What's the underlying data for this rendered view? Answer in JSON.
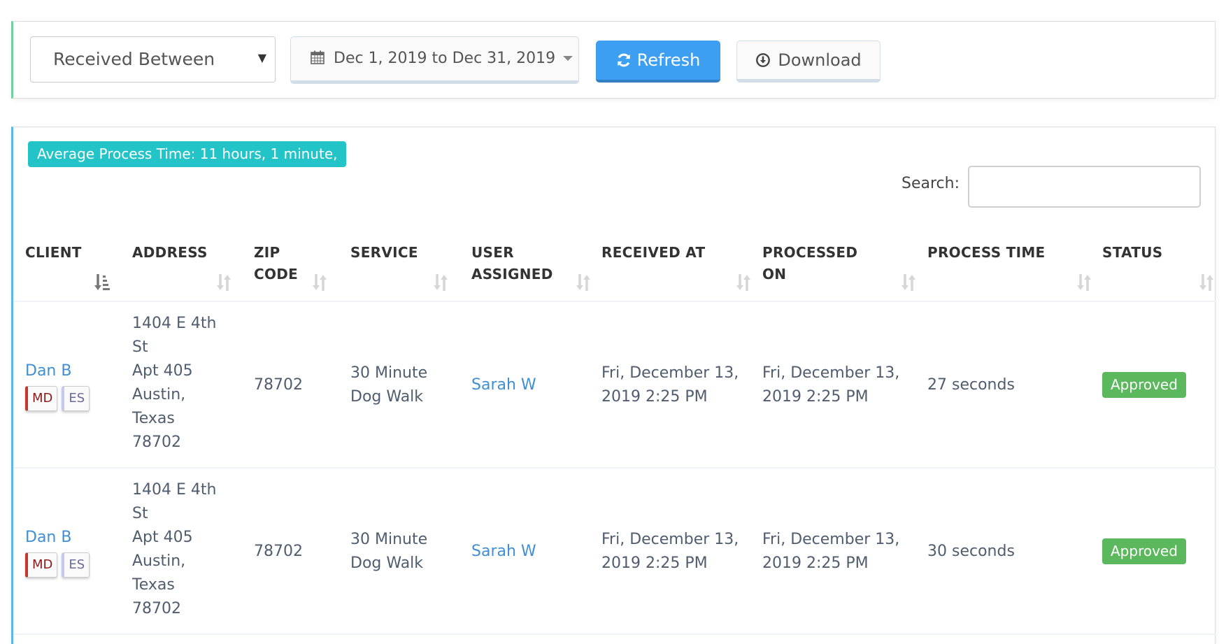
{
  "filters": {
    "date_field_select": "Received Between",
    "date_range": "Dec 1, 2019 to Dec 31, 2019",
    "refresh_label": "Refresh",
    "download_label": "Download"
  },
  "summary": {
    "average_process_time": "Average Process Time: 11 hours, 1 minute,"
  },
  "search": {
    "label": "Search:",
    "value": "",
    "placeholder": ""
  },
  "table": {
    "columns": [
      {
        "label": "CLIENT",
        "sort": "ascending"
      },
      {
        "label": "ADDRESS",
        "sort": "none"
      },
      {
        "label": "ZIP CODE",
        "sort": "none"
      },
      {
        "label": "SERVICE",
        "sort": "none"
      },
      {
        "label": "USER ASSIGNED",
        "sort": "none"
      },
      {
        "label": "RECEIVED AT",
        "sort": "none"
      },
      {
        "label": "PROCESSED ON",
        "sort": "none"
      },
      {
        "label": "PROCESS TIME",
        "sort": "none"
      },
      {
        "label": "STATUS",
        "sort": "none"
      }
    ],
    "rows": [
      {
        "client": "Dan B",
        "tags": [
          "MD",
          "ES"
        ],
        "address_lines": [
          "1404 E 4th",
          "St",
          "Apt 405",
          "Austin,",
          "Texas",
          "78702"
        ],
        "zip": "78702",
        "service_lines": [
          "30 Minute",
          "Dog Walk"
        ],
        "user_assigned": "Sarah W",
        "received_at_lines": [
          "Fri, December 13,",
          "2019 2:25 PM"
        ],
        "processed_on_lines": [
          "Fri, December 13,",
          "2019 2:25 PM"
        ],
        "process_time": "27 seconds",
        "status": "Approved"
      },
      {
        "client": "Dan B",
        "tags": [
          "MD",
          "ES"
        ],
        "address_lines": [
          "1404 E 4th",
          "St",
          "Apt 405",
          "Austin,",
          "Texas",
          "78702"
        ],
        "zip": "78702",
        "service_lines": [
          "30 Minute",
          "Dog Walk"
        ],
        "user_assigned": "Sarah W",
        "received_at_lines": [
          "Fri, December 13,",
          "2019 2:25 PM"
        ],
        "processed_on_lines": [
          "Fri, December 13,",
          "2019 2:25 PM"
        ],
        "process_time": "30 seconds",
        "status": "Approved"
      }
    ]
  },
  "colors": {
    "primary": "#3d9ff1",
    "info_badge": "#22c4c8",
    "success": "#5cb85c",
    "link": "#3f8fd2",
    "tag_md": "#c0392b",
    "tag_es": "#c5c8f0"
  }
}
